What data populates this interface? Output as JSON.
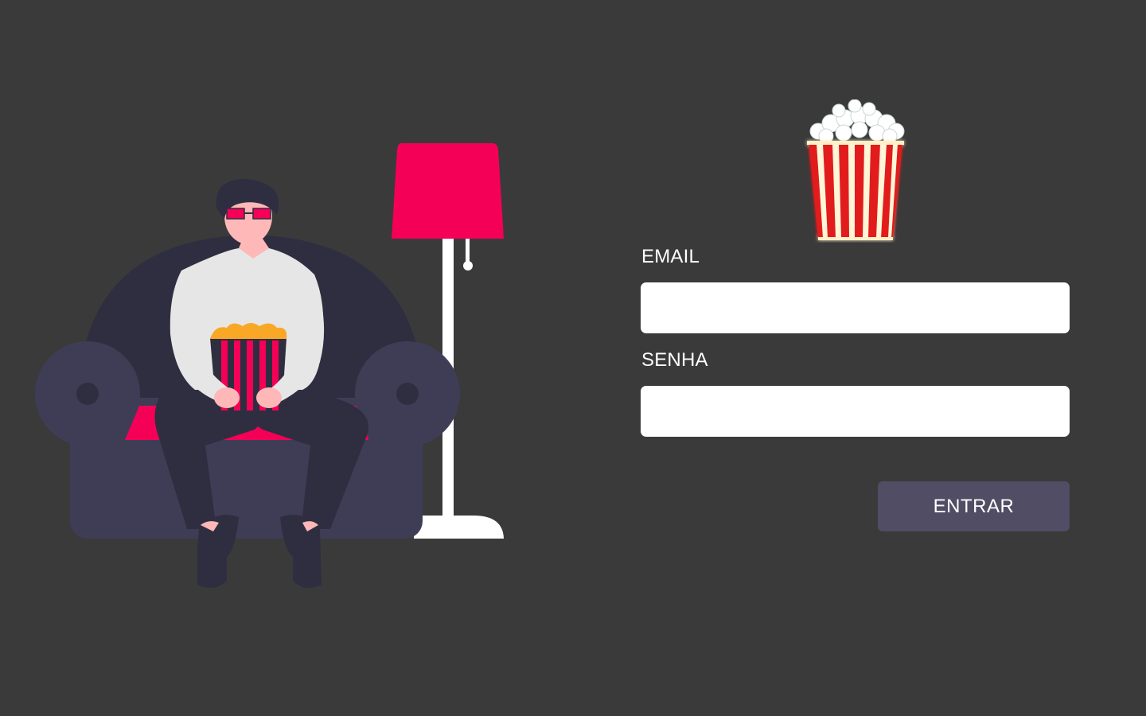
{
  "form": {
    "email_label": "EMAIL",
    "email_value": "",
    "email_placeholder": "",
    "password_label": "SENHA",
    "password_value": "",
    "password_placeholder": "",
    "submit_label": "ENTRAR"
  },
  "icons": {
    "logo": "popcorn-icon",
    "illustration": "person-on-couch-watching-movie"
  },
  "colors": {
    "background": "#3a3a3a",
    "accent": "#f50057",
    "button": "#504d65",
    "couch": "#3f3d56",
    "couch_dark": "#2f2e41",
    "shirt": "#e6e6e6",
    "popcorn_red": "#e21b1b"
  }
}
